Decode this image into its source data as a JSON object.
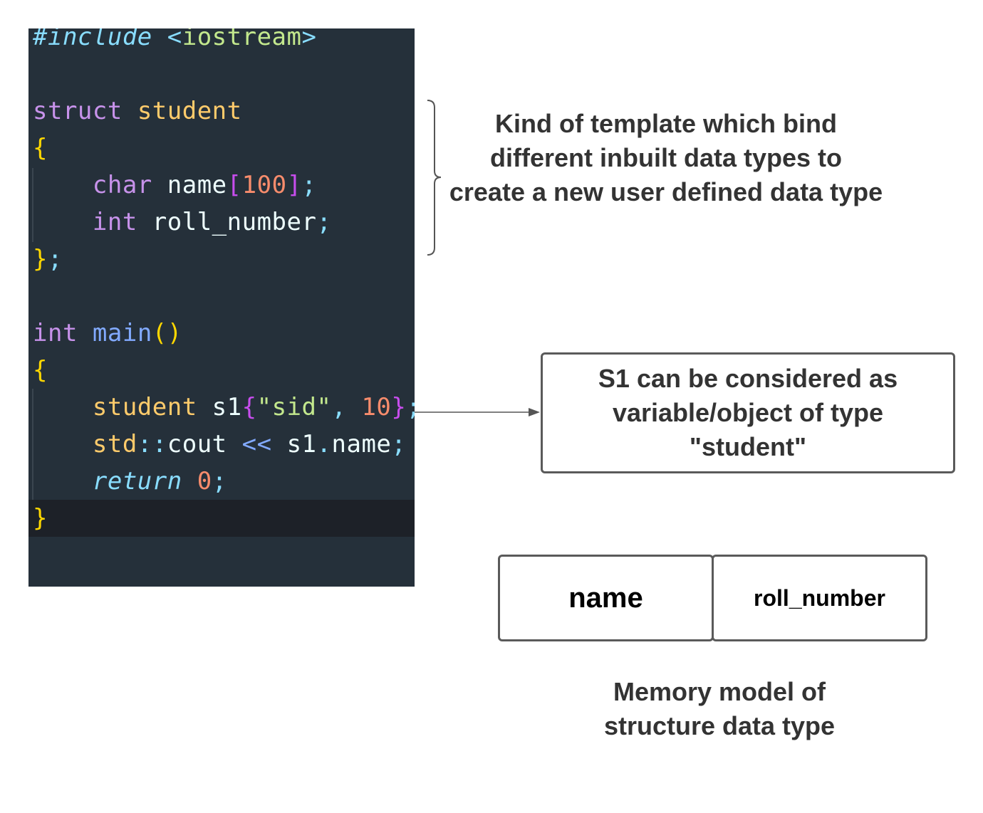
{
  "code_lines": [
    [
      {
        "t": "#include",
        "c": "cy it"
      },
      {
        "t": " "
      },
      {
        "t": "<",
        "c": "cy"
      },
      {
        "t": "iostream",
        "c": "st"
      },
      {
        "t": ">",
        "c": "cy"
      }
    ],
    [],
    [
      {
        "t": "struct",
        "c": "kw"
      },
      {
        "t": " "
      },
      {
        "t": "student",
        "c": "ty"
      }
    ],
    [
      {
        "t": "{",
        "c": "yl"
      }
    ],
    [
      {
        "t": "    "
      },
      {
        "t": "char",
        "c": "kw"
      },
      {
        "t": " "
      },
      {
        "t": "name",
        "c": "id"
      },
      {
        "t": "[",
        "c": "br"
      },
      {
        "t": "100",
        "c": "num"
      },
      {
        "t": "]",
        "c": "br"
      },
      {
        "t": ";",
        "c": "cy"
      }
    ],
    [
      {
        "t": "    "
      },
      {
        "t": "int",
        "c": "kw"
      },
      {
        "t": " "
      },
      {
        "t": "roll_number",
        "c": "id"
      },
      {
        "t": ";",
        "c": "cy"
      }
    ],
    [
      {
        "t": "}",
        "c": "yl"
      },
      {
        "t": ";",
        "c": "cy"
      }
    ],
    [],
    [
      {
        "t": "int",
        "c": "kw"
      },
      {
        "t": " "
      },
      {
        "t": "main",
        "c": "pu"
      },
      {
        "t": "()",
        "c": "yl"
      }
    ],
    [
      {
        "t": "{",
        "c": "yl"
      }
    ],
    [
      {
        "t": "    "
      },
      {
        "t": "student",
        "c": "ty"
      },
      {
        "t": " "
      },
      {
        "t": "s1",
        "c": "id"
      },
      {
        "t": "{",
        "c": "br"
      },
      {
        "t": "\"sid\"",
        "c": "st"
      },
      {
        "t": ",",
        "c": "cy"
      },
      {
        "t": " "
      },
      {
        "t": "10",
        "c": "num"
      },
      {
        "t": "}",
        "c": "br"
      },
      {
        "t": ";",
        "c": "cy"
      }
    ],
    [
      {
        "t": "    "
      },
      {
        "t": "std",
        "c": "ty"
      },
      {
        "t": "::",
        "c": "cy"
      },
      {
        "t": "cout",
        "c": "id"
      },
      {
        "t": " "
      },
      {
        "t": "<<",
        "c": "pu"
      },
      {
        "t": " "
      },
      {
        "t": "s1",
        "c": "id"
      },
      {
        "t": ".",
        "c": "cy"
      },
      {
        "t": "name",
        "c": "id"
      },
      {
        "t": ";",
        "c": "cy"
      }
    ],
    [
      {
        "t": "    "
      },
      {
        "t": "return",
        "c": "cy it"
      },
      {
        "t": " "
      },
      {
        "t": "0",
        "c": "num"
      },
      {
        "t": ";",
        "c": "cy"
      }
    ],
    [
      {
        "t": "}",
        "c": "yl"
      }
    ]
  ],
  "annotations": {
    "struct_description": "Kind of template which bind different inbuilt data types to create a new user defined data type",
    "object_description": "S1 can be considered as variable/object of type \"student\"",
    "memory_caption": "Memory model of structure data type"
  },
  "memory_model": {
    "fields": [
      "name",
      "roll_number"
    ]
  }
}
